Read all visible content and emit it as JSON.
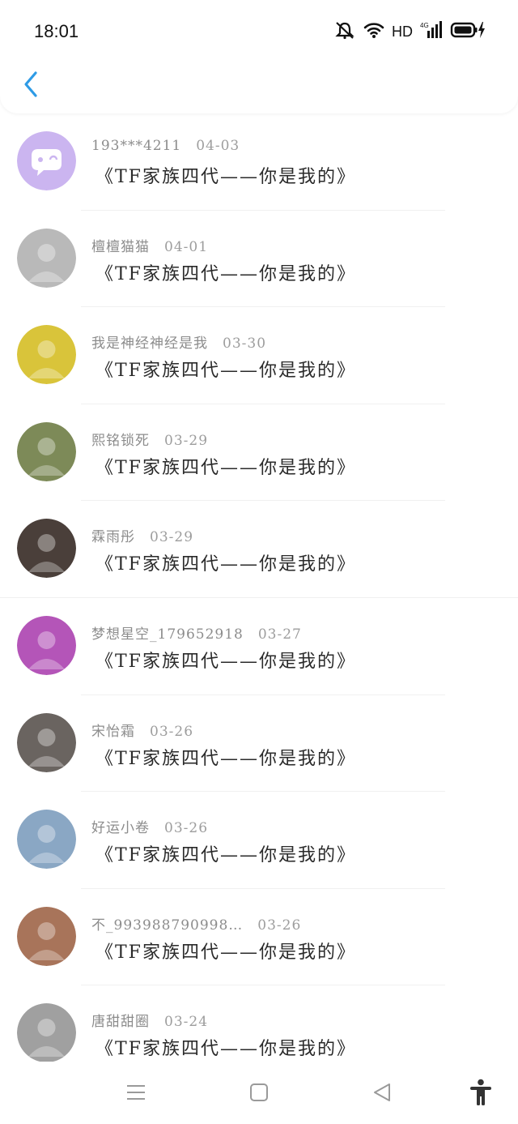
{
  "status_bar": {
    "time": "18:01",
    "network_label": "HD",
    "network_type": "4G",
    "icons": [
      "mute-icon",
      "wifi-icon",
      "signal-icon",
      "battery-charging-icon"
    ]
  },
  "header": {
    "back_icon": "chevron-left-icon",
    "accent": "#2e9be6"
  },
  "messages": [
    {
      "name": "193***4211",
      "date": "04-03",
      "text": "《TF家族四代——你是我的》",
      "avatar_bg": "#cbb5f0",
      "avatar_type": "default-chat"
    },
    {
      "name": "檀檀猫猫",
      "date": "04-01",
      "text": "《TF家族四代——你是我的》",
      "avatar_bg": "#b9b9b9"
    },
    {
      "name": "我是神经神经是我",
      "date": "03-30",
      "text": "《TF家族四代——你是我的》",
      "avatar_bg": "#d9c43a"
    },
    {
      "name": "熙铭锁死",
      "date": "03-29",
      "text": "《TF家族四代——你是我的》",
      "avatar_bg": "#7d8a58"
    },
    {
      "name": "霖雨彤",
      "date": "03-29",
      "text": "《TF家族四代——你是我的》",
      "avatar_bg": "#4a3f3a"
    },
    {
      "name": "梦想星空_179652918",
      "date": "03-27",
      "text": "《TF家族四代——你是我的》",
      "avatar_bg": "#b455b8"
    },
    {
      "name": "宋怡霜",
      "date": "03-26",
      "text": "《TF家族四代——你是我的》",
      "avatar_bg": "#6a6460"
    },
    {
      "name": "好运小卷",
      "date": "03-26",
      "text": "《TF家族四代——你是我的》",
      "avatar_bg": "#8aa7c4"
    },
    {
      "name": "不_993988790998…",
      "date": "03-26",
      "text": "《TF家族四代——你是我的》",
      "avatar_bg": "#a8745a"
    },
    {
      "name": "唐甜甜圈",
      "date": "03-24",
      "text": "《TF家族四代——你是我的》",
      "avatar_bg": "#a0a0a0"
    }
  ],
  "nav_bar": {
    "items": [
      "menu-icon",
      "home-square-icon",
      "back-triangle-icon",
      "accessibility-icon"
    ]
  }
}
